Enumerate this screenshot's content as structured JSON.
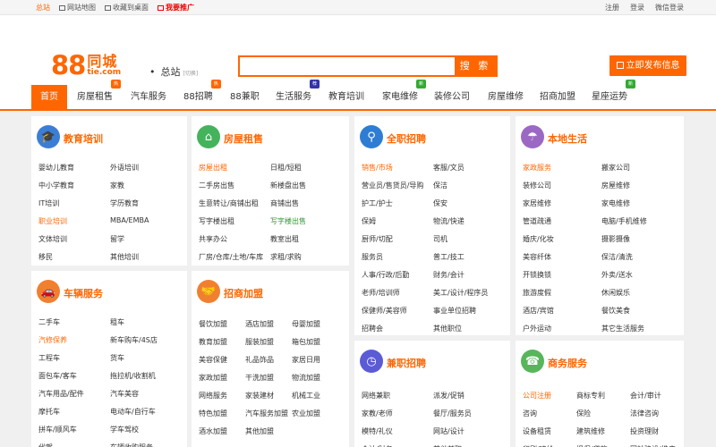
{
  "topbar": {
    "home": "总站",
    "sitemap": "网站地图",
    "favorite": "收藏到桌面",
    "promo": "我要推广",
    "register": "注册",
    "login": "登录",
    "wechat_login": "微信登录"
  },
  "logo": {
    "num": "88",
    "cn": "同城",
    "domain": "tie.com"
  },
  "city": {
    "name": "总站",
    "switch": "[切换]"
  },
  "search": {
    "placeholder": "",
    "button": "搜 索"
  },
  "post_button": "立即发布信息",
  "nav": [
    {
      "label": "首页"
    },
    {
      "label": "房屋租售",
      "badge": "热"
    },
    {
      "label": "汽车服务"
    },
    {
      "label": "88招聘",
      "badge": "热"
    },
    {
      "label": "88兼职"
    },
    {
      "label": "生活服务",
      "badge": "荐"
    },
    {
      "label": "教育培训"
    },
    {
      "label": "家电维修",
      "badge": "新"
    },
    {
      "label": "装修公司"
    },
    {
      "label": "房屋维修"
    },
    {
      "label": "招商加盟"
    },
    {
      "label": "星座运势",
      "badge": "新"
    }
  ],
  "sections": {
    "edu": {
      "title": "教育培训",
      "icon": "graduation-cap-icon",
      "color": "#3b7ed6",
      "items": [
        "婴幼儿教育",
        "外语培训",
        "中小学教育",
        "家教",
        "IT培训",
        "学历教育",
        "职业培训",
        "MBA/EMBA",
        "文体培训",
        "留学",
        "移民",
        "其他培训"
      ]
    },
    "house": {
      "title": "房屋租售",
      "icon": "house-icon",
      "color": "#44b35c",
      "items": [
        "房屋出租",
        "日租/短租",
        "二手房出售",
        "新楼盘出售",
        "生意转让/商铺出租",
        "商铺出售",
        "写字楼出租",
        "写字楼出售",
        "共享办公",
        "教室出租",
        "厂房/仓库/土地/车库",
        "求租/求购"
      ]
    },
    "jobs": {
      "title": "全职招聘",
      "icon": "job-search-icon",
      "color": "#2f7dd3",
      "items": [
        "销售/市场",
        "客服/文员",
        "营业员/售货员/导购",
        "保洁",
        "护工/护士",
        "保安",
        "保姆",
        "物流/快递",
        "厨师/切配",
        "司机",
        "服务员",
        "普工/技工",
        "人事/行政/后勤",
        "财务/会计",
        "老师/培训师",
        "美工/设计/程序员",
        "保健师/美容师",
        "事业单位招聘",
        "招聘会",
        "其他职位"
      ]
    },
    "life": {
      "title": "本地生活",
      "icon": "umbrella-icon",
      "color": "#9b69c3",
      "items": [
        "家政服务",
        "搬家公司",
        "装修公司",
        "房屋维修",
        "家居维修",
        "家电维修",
        "管道疏通",
        "电脑/手机维修",
        "婚庆/化妆",
        "摄影摄像",
        "美容纤体",
        "保洁/清洗",
        "开锁换锁",
        "外卖/送水",
        "旅游度假",
        "休闲娱乐",
        "酒店/宾馆",
        "餐饮美食",
        "户外运动",
        "其它生活服务"
      ]
    },
    "car": {
      "title": "车辆服务",
      "icon": "car-icon",
      "color": "#f08030",
      "items": [
        "二手车",
        "租车",
        "汽修保养",
        "新车购车/4S店",
        "工程车",
        "货车",
        "面包车/客车",
        "拖拉机/收割机",
        "汽车用品/配件",
        "汽车美容",
        "摩托车",
        "电动车/自行车",
        "拼车/顺风车",
        "学车驾校",
        "代驾",
        "车辆收购服务"
      ]
    },
    "franchise": {
      "title": "招商加盟",
      "icon": "handshake-icon",
      "color": "#f08030",
      "items": [
        "餐饮加盟",
        "酒店加盟",
        "母婴加盟",
        "教育加盟",
        "服装加盟",
        "箱包加盟",
        "美容保健",
        "礼品饰品",
        "家居日用",
        "家政加盟",
        "干洗加盟",
        "物流加盟",
        "网络服务",
        "家装建材",
        "机械工业",
        "特色加盟",
        "汽车服务加盟",
        "农业加盟",
        "酒水加盟",
        "其他加盟"
      ]
    },
    "parttime": {
      "title": "兼职招聘",
      "icon": "clock-icon",
      "color": "#5b5bd6",
      "items": [
        "网络兼职",
        "派发/促销",
        "家教/老师",
        "餐厅/服务员",
        "模特/礼仪",
        "网站/设计",
        "会计/财务",
        "其他兼职"
      ]
    },
    "business": {
      "title": "商务服务",
      "icon": "phone-icon",
      "color": "#57b55a",
      "items": [
        "公司注册",
        "商标专利",
        "会计/审计",
        "咨询",
        "保险",
        "法律咨询",
        "设备租赁",
        "建筑维修",
        "投资理财",
        "印刷/喷绘",
        "担保/贷款",
        "网站建设/推广"
      ]
    }
  }
}
